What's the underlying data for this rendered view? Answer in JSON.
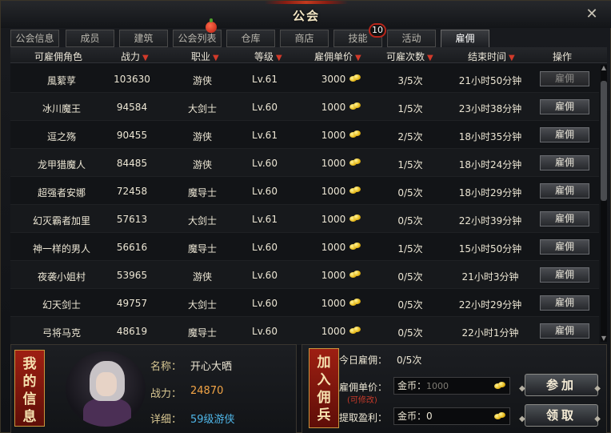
{
  "window": {
    "title": "公会",
    "close_label": "✕"
  },
  "tabs": [
    {
      "label": "公会信息",
      "active": false
    },
    {
      "label": "成员",
      "active": false
    },
    {
      "label": "建筑",
      "active": false
    },
    {
      "label": "公会列表",
      "active": false
    },
    {
      "label": "仓库",
      "active": false
    },
    {
      "label": "商店",
      "active": false
    },
    {
      "label": "技能",
      "active": false
    },
    {
      "label": "活动",
      "active": false
    },
    {
      "label": "雇佣",
      "active": true
    }
  ],
  "skill_badge": "10",
  "table": {
    "headers": {
      "role": "可雇佣角色",
      "power": "战力",
      "class": "职业",
      "level": "等级",
      "price": "雇佣单价",
      "times": "可雇次数",
      "end": "结束时间",
      "action": "操作"
    },
    "rows": [
      {
        "role": "風蕠莩",
        "power": "103630",
        "class": "游侠",
        "level": "Lv.61",
        "price": "3000",
        "times": "3/5次",
        "end": "21小时50分钟",
        "action": "雇佣",
        "disabled": true
      },
      {
        "role": "冰川魔王",
        "power": "94584",
        "class": "大剑士",
        "level": "Lv.60",
        "price": "1000",
        "times": "1/5次",
        "end": "23小时38分钟",
        "action": "雇佣",
        "disabled": false
      },
      {
        "role": "逗之殇",
        "power": "90455",
        "class": "游侠",
        "level": "Lv.61",
        "price": "1000",
        "times": "2/5次",
        "end": "18小时35分钟",
        "action": "雇佣",
        "disabled": false
      },
      {
        "role": "龙甲猎魔人",
        "power": "84485",
        "class": "游侠",
        "level": "Lv.60",
        "price": "1000",
        "times": "1/5次",
        "end": "18小时24分钟",
        "action": "雇佣",
        "disabled": false
      },
      {
        "role": "超强者安娜",
        "power": "72458",
        "class": "魔导士",
        "level": "Lv.60",
        "price": "1000",
        "times": "0/5次",
        "end": "18小时29分钟",
        "action": "雇佣",
        "disabled": false
      },
      {
        "role": "幻灭霸者加里",
        "power": "57613",
        "class": "大剑士",
        "level": "Lv.61",
        "price": "1000",
        "times": "0/5次",
        "end": "22小时39分钟",
        "action": "雇佣",
        "disabled": false
      },
      {
        "role": "神一样的男人",
        "power": "56616",
        "class": "魔导士",
        "level": "Lv.60",
        "price": "1000",
        "times": "1/5次",
        "end": "15小时50分钟",
        "action": "雇佣",
        "disabled": false
      },
      {
        "role": "夜袭小姐村",
        "power": "53965",
        "class": "游侠",
        "level": "Lv.60",
        "price": "1000",
        "times": "0/5次",
        "end": "21小时3分钟",
        "action": "雇佣",
        "disabled": false
      },
      {
        "role": "幻天剑士",
        "power": "49757",
        "class": "大剑士",
        "level": "Lv.60",
        "price": "1000",
        "times": "0/5次",
        "end": "22小时29分钟",
        "action": "雇佣",
        "disabled": false
      },
      {
        "role": "弓将马克",
        "power": "48619",
        "class": "魔导士",
        "level": "Lv.60",
        "price": "1000",
        "times": "0/5次",
        "end": "22小时1分钟",
        "action": "雇佣",
        "disabled": false
      }
    ]
  },
  "my_info": {
    "title_chars": [
      "我",
      "的",
      "信",
      "息"
    ],
    "name_label": "名称：",
    "name_value": "开心大晒",
    "power_label": "战力：",
    "power_value": "24870",
    "detail_label": "详细：",
    "detail_value": "59级游侠"
  },
  "join": {
    "title_chars": [
      "加",
      "入",
      "佣",
      "兵"
    ],
    "today_label": "今日雇佣：",
    "today_value": "0/5次",
    "price_label": "雇佣单价：",
    "price_note": "(可修改)",
    "price_field_prefix": "金币：",
    "price_placeholder": "1000",
    "profit_label": "提取盈利：",
    "profit_value": "金币：0",
    "join_button": "参加",
    "claim_button": "领取"
  },
  "colors": {
    "accent_red": "#9e1f12",
    "gold": "#e6b818",
    "orange_value": "#f2a446",
    "blue_value": "#4fb6e8"
  },
  "icons": [
    "close-icon",
    "gold-coin-icon",
    "sort-down-icon",
    "apple-icon"
  ]
}
